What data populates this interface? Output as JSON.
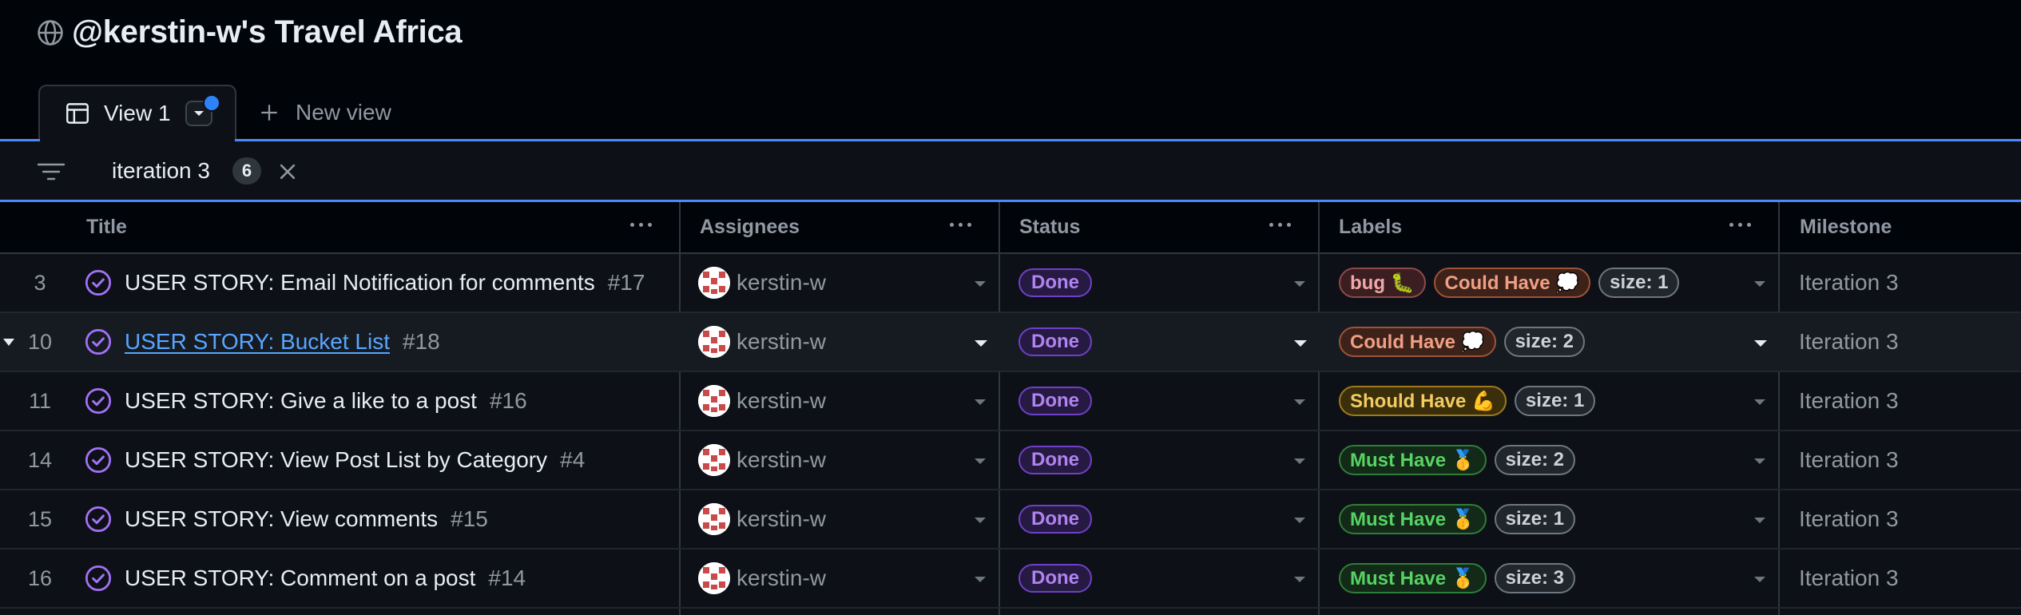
{
  "project": {
    "title": "@kerstin-w's Travel Africa",
    "icon": "globe-icon"
  },
  "tabs": {
    "active": {
      "label": "View 1",
      "icon": "table-icon"
    },
    "new_view_label": "New view"
  },
  "filter": {
    "text": "iteration 3",
    "count": "6"
  },
  "columns": {
    "title": "Title",
    "assignees": "Assignees",
    "status": "Status",
    "labels": "Labels",
    "milestone": "Milestone"
  },
  "colors": {
    "accent": "#4c8bf5",
    "done_purple": "#b083f0",
    "link": "#58a6ff"
  },
  "rows": [
    {
      "num": "3",
      "title": "USER STORY: Email Notification for comments",
      "issue": "#17",
      "assignee": "kerstin-w",
      "status": "Done",
      "labels": [
        {
          "text": "bug 🐛",
          "color": "#f0a8a8",
          "border": "#8e4a4a",
          "bg": "#3b1e21"
        },
        {
          "text": "Could Have 💭",
          "color": "#f09e84",
          "border": "#a05238",
          "bg": "#3d2219"
        },
        {
          "text": "size: 1",
          "color": "#c9d1d9",
          "border": "#6e7681",
          "bg": "#21262d"
        }
      ],
      "milestone": "Iteration 3"
    },
    {
      "num": "10",
      "title": "USER STORY: Bucket List",
      "issue": "#18",
      "assignee": "kerstin-w",
      "status": "Done",
      "labels": [
        {
          "text": "Could Have 💭",
          "color": "#f09e84",
          "border": "#a05238",
          "bg": "#3d2219"
        },
        {
          "text": "size: 2",
          "color": "#c9d1d9",
          "border": "#6e7681",
          "bg": "#21262d"
        },
        {
          "text": "",
          "color": "",
          "border": "",
          "bg": ""
        }
      ],
      "milestone": "Iteration 3"
    },
    {
      "num": "11",
      "title": "USER STORY: Give a like to a post",
      "issue": "#16",
      "assignee": "kerstin-w",
      "status": "Done",
      "labels": [
        {
          "text": "Should Have 💪",
          "color": "#f2cc60",
          "border": "#9e7a1c",
          "bg": "#3a2e0b"
        },
        {
          "text": "size: 1",
          "color": "#c9d1d9",
          "border": "#6e7681",
          "bg": "#21262d"
        },
        {
          "text": "",
          "color": "",
          "border": "",
          "bg": ""
        }
      ],
      "milestone": "Iteration 3"
    },
    {
      "num": "14",
      "title": "USER STORY: View Post List by Category",
      "issue": "#4",
      "assignee": "kerstin-w",
      "status": "Done",
      "labels": [
        {
          "text": "Must Have 🥇",
          "color": "#56d364",
          "border": "#2f7d3a",
          "bg": "#132a18"
        },
        {
          "text": "size: 2",
          "color": "#c9d1d9",
          "border": "#6e7681",
          "bg": "#21262d"
        },
        {
          "text": "",
          "color": "",
          "border": "",
          "bg": ""
        }
      ],
      "milestone": "Iteration 3"
    },
    {
      "num": "15",
      "title": "USER STORY: View comments",
      "issue": "#15",
      "assignee": "kerstin-w",
      "status": "Done",
      "labels": [
        {
          "text": "Must Have 🥇",
          "color": "#56d364",
          "border": "#2f7d3a",
          "bg": "#132a18"
        },
        {
          "text": "size: 1",
          "color": "#c9d1d9",
          "border": "#6e7681",
          "bg": "#21262d"
        },
        {
          "text": "",
          "color": "",
          "border": "",
          "bg": ""
        }
      ],
      "milestone": "Iteration 3"
    },
    {
      "num": "16",
      "title": "USER STORY: Comment on a post",
      "issue": "#14",
      "assignee": "kerstin-w",
      "status": "Done",
      "labels": [
        {
          "text": "Must Have 🥇",
          "color": "#56d364",
          "border": "#2f7d3a",
          "bg": "#132a18"
        },
        {
          "text": "size: 3",
          "color": "#c9d1d9",
          "border": "#6e7681",
          "bg": "#21262d"
        },
        {
          "text": "",
          "color": "",
          "border": "",
          "bg": ""
        }
      ],
      "milestone": "Iteration 3"
    }
  ]
}
